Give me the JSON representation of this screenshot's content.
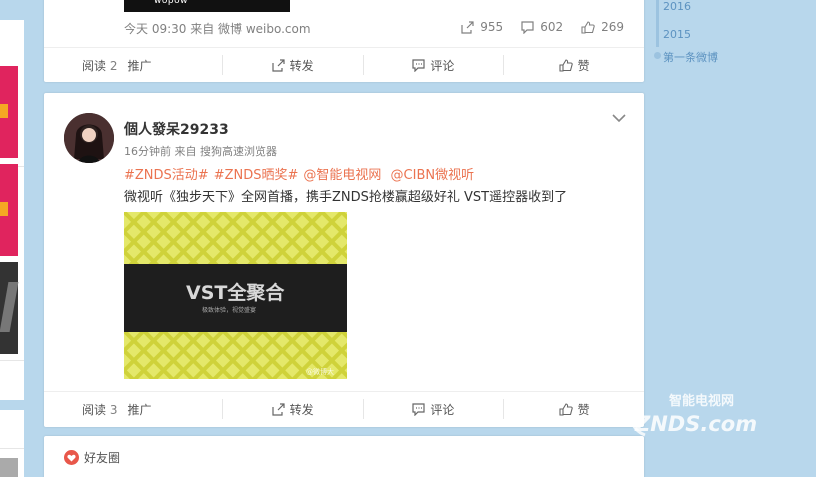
{
  "top_post": {
    "video_brand": "wopow",
    "meta": "今天 09:30 来自 微博 weibo.com",
    "stats": {
      "repost": "955",
      "comment": "602",
      "like": "269"
    },
    "actions": {
      "reads_label": "阅读",
      "reads_count": "2",
      "promote": "推广",
      "repost": "转发",
      "comment": "评论",
      "like": "赞"
    }
  },
  "post": {
    "username": "個人發呆29233",
    "meta": "16分钟前 来自 搜狗高速浏览器",
    "tags": [
      "#ZNDS活动#",
      "#ZNDS晒奖#",
      "@智能电视网",
      "@CIBN微视听"
    ],
    "text": "微视听《独步天下》全网首播，携手ZNDS抢楼赢超级好礼  VST遥控器收到了",
    "image": {
      "product_brand": "VST全聚合",
      "product_slogan": "极致体验，视觉盛宴",
      "watermark": "@微博大"
    },
    "actions": {
      "reads_label": "阅读",
      "reads_count": "3",
      "promote": "推广",
      "repost": "转发",
      "comment": "评论",
      "like": "赞"
    }
  },
  "friends_circle": {
    "label": "好友圈"
  },
  "timeline": {
    "years": [
      "2016",
      "2015"
    ],
    "first_post": "第一条微博"
  },
  "site_watermark": {
    "line1": "智能电视网",
    "line2": "ZNDS.com"
  },
  "colors": {
    "link": "#eb7350",
    "timeline": "#5d93c1",
    "background": "#b8d7ec",
    "heart": "#e8574a"
  }
}
